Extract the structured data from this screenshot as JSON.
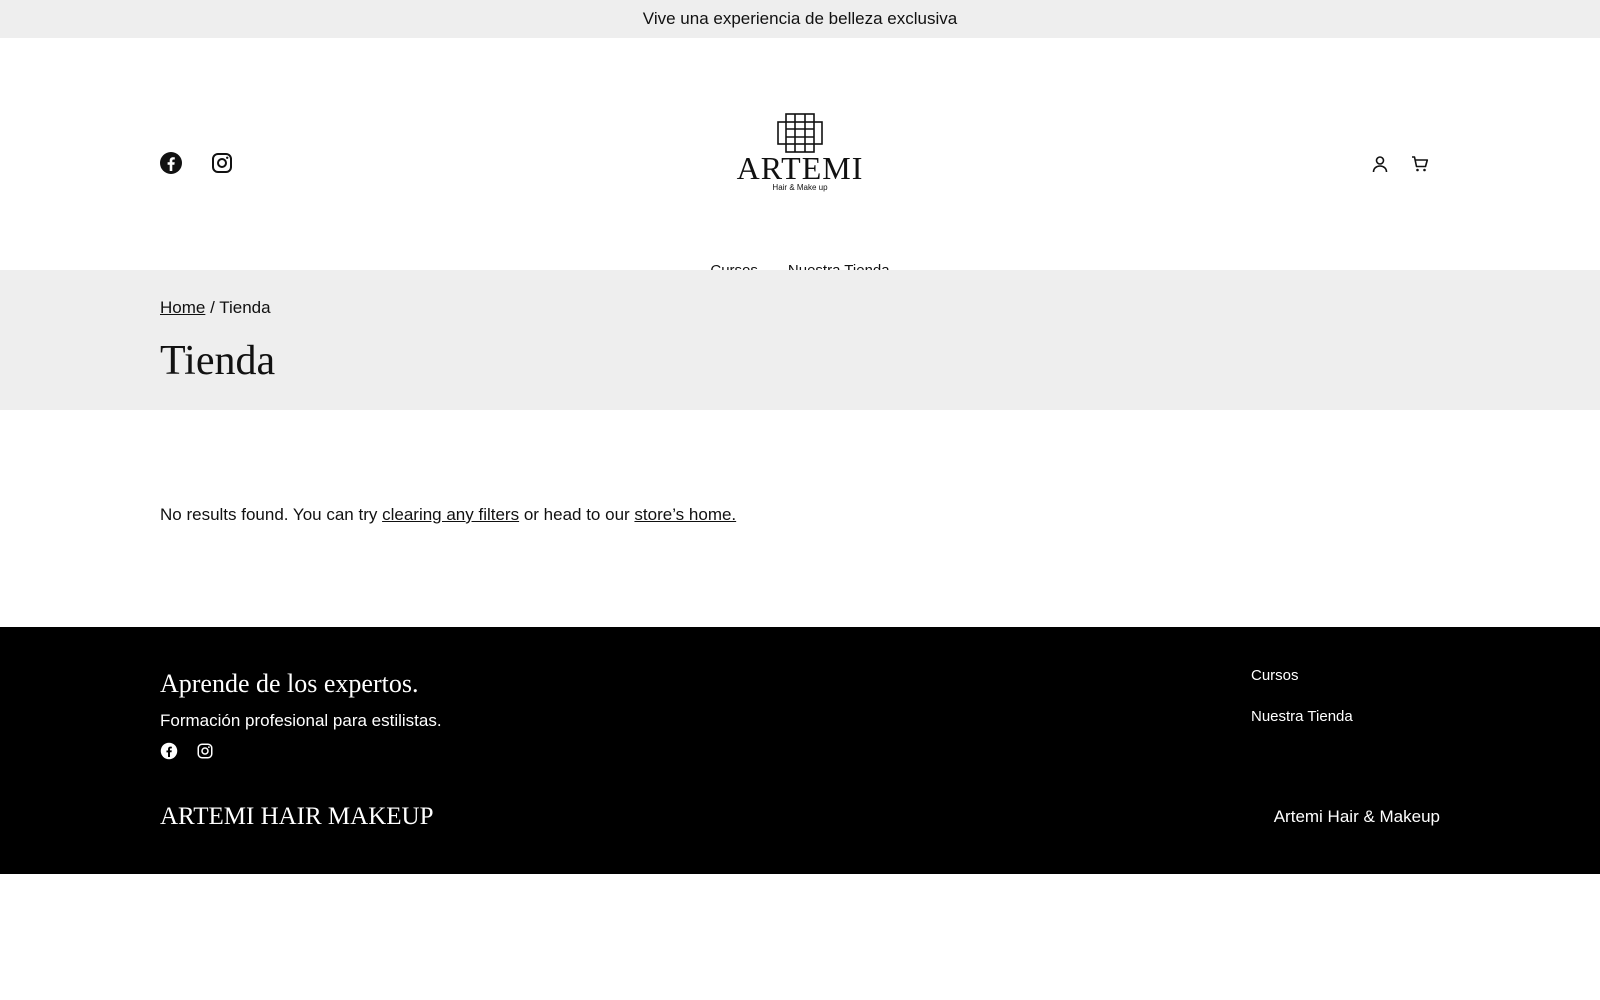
{
  "announcement": "Vive una experiencia de belleza exclusiva",
  "header": {
    "logo_word": "ARTEMI",
    "logo_sub": "Hair & Make up",
    "social_icons": [
      "facebook-icon",
      "instagram-icon"
    ],
    "action_icons": [
      "account-icon",
      "cart-icon"
    ]
  },
  "nav": {
    "items": [
      "Cursos",
      "Nuestra Tienda"
    ]
  },
  "hero": {
    "breadcrumb_home": "Home",
    "breadcrumb_sep": " / ",
    "breadcrumb_current": "Tienda",
    "title": "Tienda"
  },
  "main": {
    "notice_prefix": "No results found. You can try ",
    "notice_link1": "clearing any filters",
    "notice_middle": " or head to our ",
    "notice_link2": "store’s home."
  },
  "footer": {
    "heading": "Aprende de los expertos.",
    "tagline": "Formación profesional para estilistas.",
    "nav_items": [
      "Cursos",
      "Nuestra Tienda"
    ],
    "brand": "ARTEMI HAIR MAKEUP",
    "credit": "Artemi Hair & Makeup",
    "background": "#000000",
    "text_color": "#ffffff"
  },
  "colors": {
    "bar_bg": "#eeeeee",
    "text": "#111111"
  }
}
